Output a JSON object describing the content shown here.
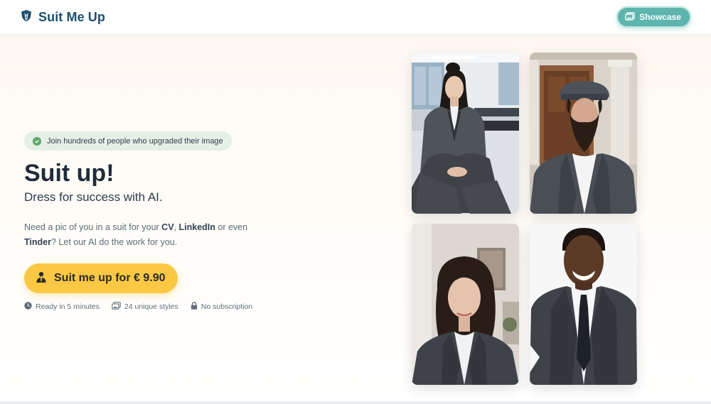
{
  "header": {
    "brand": "Suit Me Up",
    "showcase_label": "Showcase"
  },
  "hero": {
    "badge": "Join hundreds of people who upgraded their image",
    "title": "Suit up!",
    "subtitle": "Dress for success with AI.",
    "desc_1": "Need a pic of you in a suit for your ",
    "desc_cv": "CV",
    "desc_comma": ", ",
    "desc_linkedin": "LinkedIn",
    "desc_2": " or even ",
    "desc_tinder": "Tinder",
    "desc_3": "? Let our AI do the work for you.",
    "cta_label": "Suit me up for € 9.90",
    "features": [
      {
        "icon": "clock-icon",
        "label": "Ready in 5 minutes"
      },
      {
        "icon": "images-icon",
        "label": "24 unique styles"
      },
      {
        "icon": "lock-icon",
        "label": "No subscription"
      }
    ]
  },
  "colors": {
    "brand": "#1d4e6e",
    "accent_teal": "#5eb5ae",
    "cta_yellow": "#fbc844",
    "badge_green": "#5fa66a"
  }
}
